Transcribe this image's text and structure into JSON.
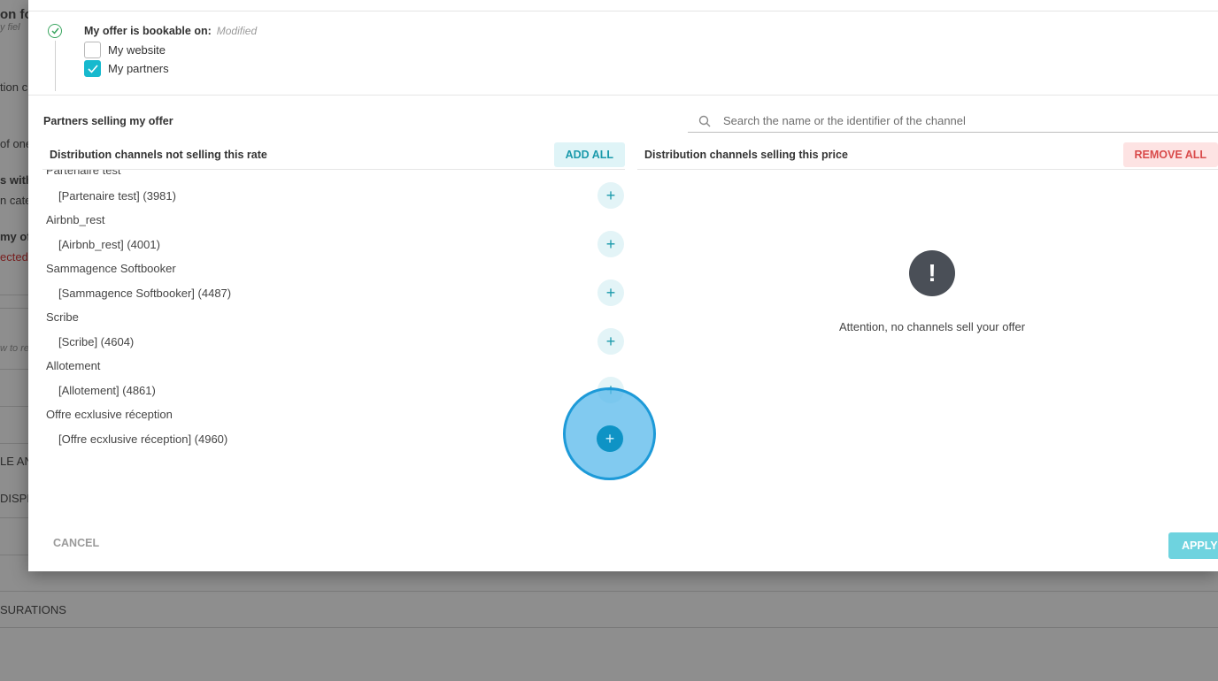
{
  "background": {
    "fragments": [
      "on fo",
      "y fiel",
      "tion c",
      "of one",
      "s with",
      "n cate",
      "my of",
      "ected",
      "w to re",
      "LE AN",
      "DISPL",
      "SURATIONS"
    ]
  },
  "bookable": {
    "title": "My offer is bookable on:",
    "status": "Modified",
    "options": [
      {
        "label": "My website",
        "checked": false
      },
      {
        "label": "My partners",
        "checked": true
      }
    ]
  },
  "partners": {
    "title": "Partners selling my offer",
    "search_placeholder": "Search the name or the identifier of the channel"
  },
  "left_column": {
    "title": "Distribution channels not selling this rate",
    "add_all_label": "ADD ALL",
    "groups": [
      {
        "name": "Partenaire test",
        "item": "[Partenaire test] (3981)"
      },
      {
        "name": "Airbnb_rest",
        "item": "[Airbnb_rest] (4001)"
      },
      {
        "name": "Sammagence Softbooker",
        "item": "[Sammagence Softbooker] (4487)"
      },
      {
        "name": "Scribe",
        "item": "[Scribe] (4604)"
      },
      {
        "name": "Allotement",
        "item": "[Allotement] (4861)"
      },
      {
        "name": "Offre ecxlusive réception",
        "item": "[Offre ecxlusive réception] (4960)"
      }
    ]
  },
  "right_column": {
    "title": "Distribution channels selling this price",
    "remove_all_label": "REMOVE ALL",
    "empty_message": "Attention, no channels sell your offer"
  },
  "footer": {
    "cancel_label": "CANCEL",
    "apply_label": "APPLY"
  },
  "colors": {
    "accent": "#17b9ce",
    "danger": "#d94a4a",
    "success": "#3aa660"
  }
}
